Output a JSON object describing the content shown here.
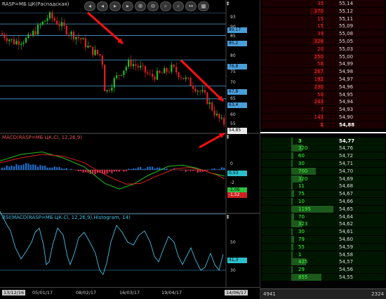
{
  "chart": {
    "price_label": "RASP=МБ ЦК(Распадская)",
    "macd_label": "MACD(RASP=МБ ЦК.Cl, 12,26,9)",
    "rsi_label": "RSI(MACD(RASP=МБ ЦК.Cl, 12,26,9),Histogram, 14)",
    "collapse_glyph": "⇞",
    "toolbar": [
      "◂",
      "◂",
      "▸",
      "▸",
      "⊕",
      "⊖",
      "⌕",
      "⌕",
      "↔",
      "▦"
    ],
    "price_axis": [
      "93",
      "90",
      "89,17",
      "85",
      "85,2",
      "80",
      "76,8",
      "75",
      "70",
      "67,8",
      "65",
      "63,4",
      "60",
      "55"
    ],
    "macd_axis": [
      "0",
      "-2"
    ],
    "rsi_axis": [
      "50",
      "30"
    ],
    "price_tag": "54,85",
    "macd_tags": [
      "0,53",
      "-1,06",
      "-1,52"
    ],
    "rsi_tag": "41,3",
    "x_labels": [
      "13/12/16",
      "05/01/17",
      "08/02/17",
      "16/03/17",
      "19/04/17",
      "14/06/17"
    ],
    "colors": {
      "up": "#20c020",
      "down": "#e02020",
      "level": "#4a9fd8",
      "macd_line": "#20c020",
      "signal_line": "#e02020",
      "rsi_line": "#44bce0",
      "arrow": "#ff1010"
    }
  },
  "chart_data": {
    "type": "line",
    "x": [
      "13/12/16",
      "05/01/17",
      "08/02/17",
      "16/03/17",
      "19/04/17",
      "14/06/17"
    ],
    "series": [
      {
        "values": [
          86,
          90,
          86,
          71,
          73,
          70,
          57
        ]
      }
    ],
    "ylim": [
      52,
      95
    ]
  },
  "orderbook": {
    "asks": [
      {
        "qty": "35",
        "price": "55,14"
      },
      {
        "qty": "370",
        "price": "55,12"
      },
      {
        "qty": "15",
        "price": "55,11"
      },
      {
        "qty": "15",
        "price": "55,09"
      },
      {
        "qty": "39",
        "price": "55,08"
      },
      {
        "qty": "328",
        "price": "55,05"
      },
      {
        "qty": "20",
        "price": "55,03"
      },
      {
        "qty": "250",
        "price": "55,00"
      },
      {
        "qty": "58",
        "price": "54,99"
      },
      {
        "qty": "267",
        "price": "54,98"
      },
      {
        "qty": "192",
        "price": "54,97"
      },
      {
        "qty": "230",
        "price": "54,96"
      },
      {
        "qty": "50",
        "price": "54,95"
      },
      {
        "qty": "243",
        "price": "54,94"
      },
      {
        "qty": "7",
        "price": "54,93"
      },
      {
        "qty": "143",
        "price": "54,90"
      },
      {
        "qty": "1",
        "price": "54,88"
      }
    ],
    "bids": [
      {
        "qty": "3",
        "price": "54,77"
      },
      {
        "qty": "320",
        "price": "54,76"
      },
      {
        "qty": "60",
        "price": "54,72"
      },
      {
        "qty": "30",
        "price": "54,71"
      },
      {
        "qty": "700",
        "price": "54,70"
      },
      {
        "qty": "320",
        "price": "54,69"
      },
      {
        "qty": "11",
        "price": "54,68"
      },
      {
        "qty": "75",
        "price": "54,67"
      },
      {
        "qty": "10",
        "price": "54,66"
      },
      {
        "qty": "1195",
        "price": "54,65"
      },
      {
        "qty": "70",
        "price": "54,64"
      },
      {
        "qty": "323",
        "price": "54,62"
      },
      {
        "qty": "30",
        "price": "54,61"
      },
      {
        "qty": "79",
        "price": "54,60"
      },
      {
        "qty": "55",
        "price": "54,59"
      },
      {
        "qty": "1",
        "price": "54,58"
      },
      {
        "qty": "425",
        "price": "54,57"
      },
      {
        "qty": "29",
        "price": "54,56"
      },
      {
        "qty": "855",
        "price": "54,55"
      }
    ],
    "footer_left": "4941",
    "footer_right": "2324"
  }
}
